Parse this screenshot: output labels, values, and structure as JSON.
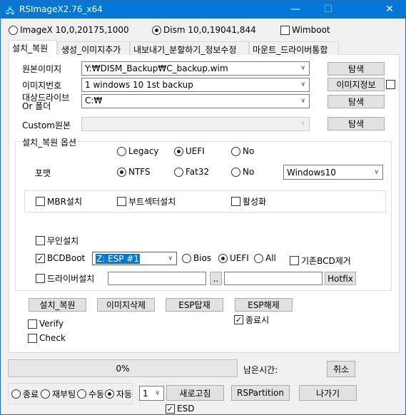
{
  "window": {
    "title": "RSImageX2.76_x64",
    "minimize": "—",
    "maximize": "☐",
    "close": "✕"
  },
  "engine": {
    "imagex": "ImageX 10,0,20175,1000",
    "dism": "Dism 10,0,19041,844",
    "selected": "dism",
    "wimboot": "Wimboot",
    "wimboot_checked": false
  },
  "tabs": [
    {
      "label": "설치_복원",
      "selected": true
    },
    {
      "label": "생성_이미지추가"
    },
    {
      "label": "내보내기_분할하기_정보수정"
    },
    {
      "label": "마운트_드라이버통합"
    }
  ],
  "form": {
    "source_label": "원본이미지",
    "source_value": "Y:₩DISM_Backup₩C_backup.wim",
    "browse": "탐색",
    "index_label": "이미지번호",
    "index_value": "1  windows 10 1st backup",
    "info_button": "이미지정보",
    "target_label1": "대상드라이브",
    "target_label2": "Or 폴더",
    "target_value": "C:₩",
    "custom_label": "Custom원본",
    "custom_value": ""
  },
  "options": {
    "legend": "설치_복원 옵션",
    "boot_modes": [
      "Legacy",
      "UEFI",
      "No"
    ],
    "boot_selected": "UEFI",
    "format_label": "포맷",
    "formats": [
      "NTFS",
      "Fat32",
      "No"
    ],
    "format_selected": "NTFS",
    "os_value": "Windows10",
    "mbr": "MBR설치",
    "bootsector": "부트섹터설치",
    "activate": "활성화",
    "unattend": "무인설치",
    "bcdboot": "BCDBoot",
    "bcdboot_checked": true,
    "esp_value": "Z: ESP #1",
    "bcd_modes": [
      "Bios",
      "UEFI",
      "All"
    ],
    "bcd_selected": "UEFI",
    "remove_bcd": "기존BCD제거",
    "driver": "드라이버설치",
    "dots": "..",
    "hotfix": "Hotfix"
  },
  "actions": {
    "install": "설치_복원",
    "delete": "이미지삭제",
    "esp_mount": "ESP탑재",
    "esp_unmount": "ESP해제",
    "on_exit": "종료시",
    "on_exit_checked": true,
    "verify": "Verify",
    "check": "Check"
  },
  "progress": {
    "percent": 0,
    "text": "0%",
    "remaining_label": "남은시간:",
    "cancel": "취소"
  },
  "bottom": {
    "after_modes": [
      "종료",
      "재부팅",
      "수동",
      "자동"
    ],
    "after_selected": "자동",
    "count_value": "1",
    "refresh": "새로고침",
    "rspartition": "RSPartition",
    "exit": "나가기",
    "esd": "ESD",
    "esd_checked": true
  }
}
